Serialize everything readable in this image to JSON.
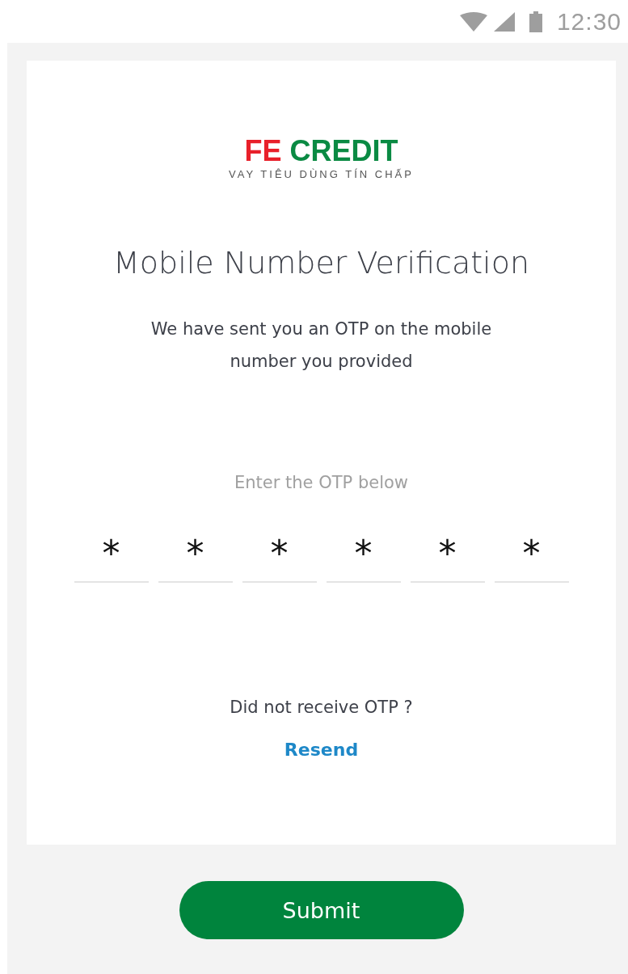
{
  "status_bar": {
    "time": "12:30"
  },
  "logo": {
    "part_1": "FE",
    "part_2": "CREDIT",
    "tagline": "VAY TIÊU DÙNG TÍN CHẤP"
  },
  "title": "Mobile Number Verification",
  "message": "We have sent you an OTP on the mobile number you provided",
  "otp_label": "Enter the OTP below",
  "otp_digits": [
    {
      "value": "*"
    },
    {
      "value": "*"
    },
    {
      "value": "*"
    },
    {
      "value": "*"
    },
    {
      "value": "*"
    },
    {
      "value": "*"
    }
  ],
  "resend_prompt": "Did not receive OTP ?",
  "resend_link": "Resend",
  "submit_button": "Submit"
}
